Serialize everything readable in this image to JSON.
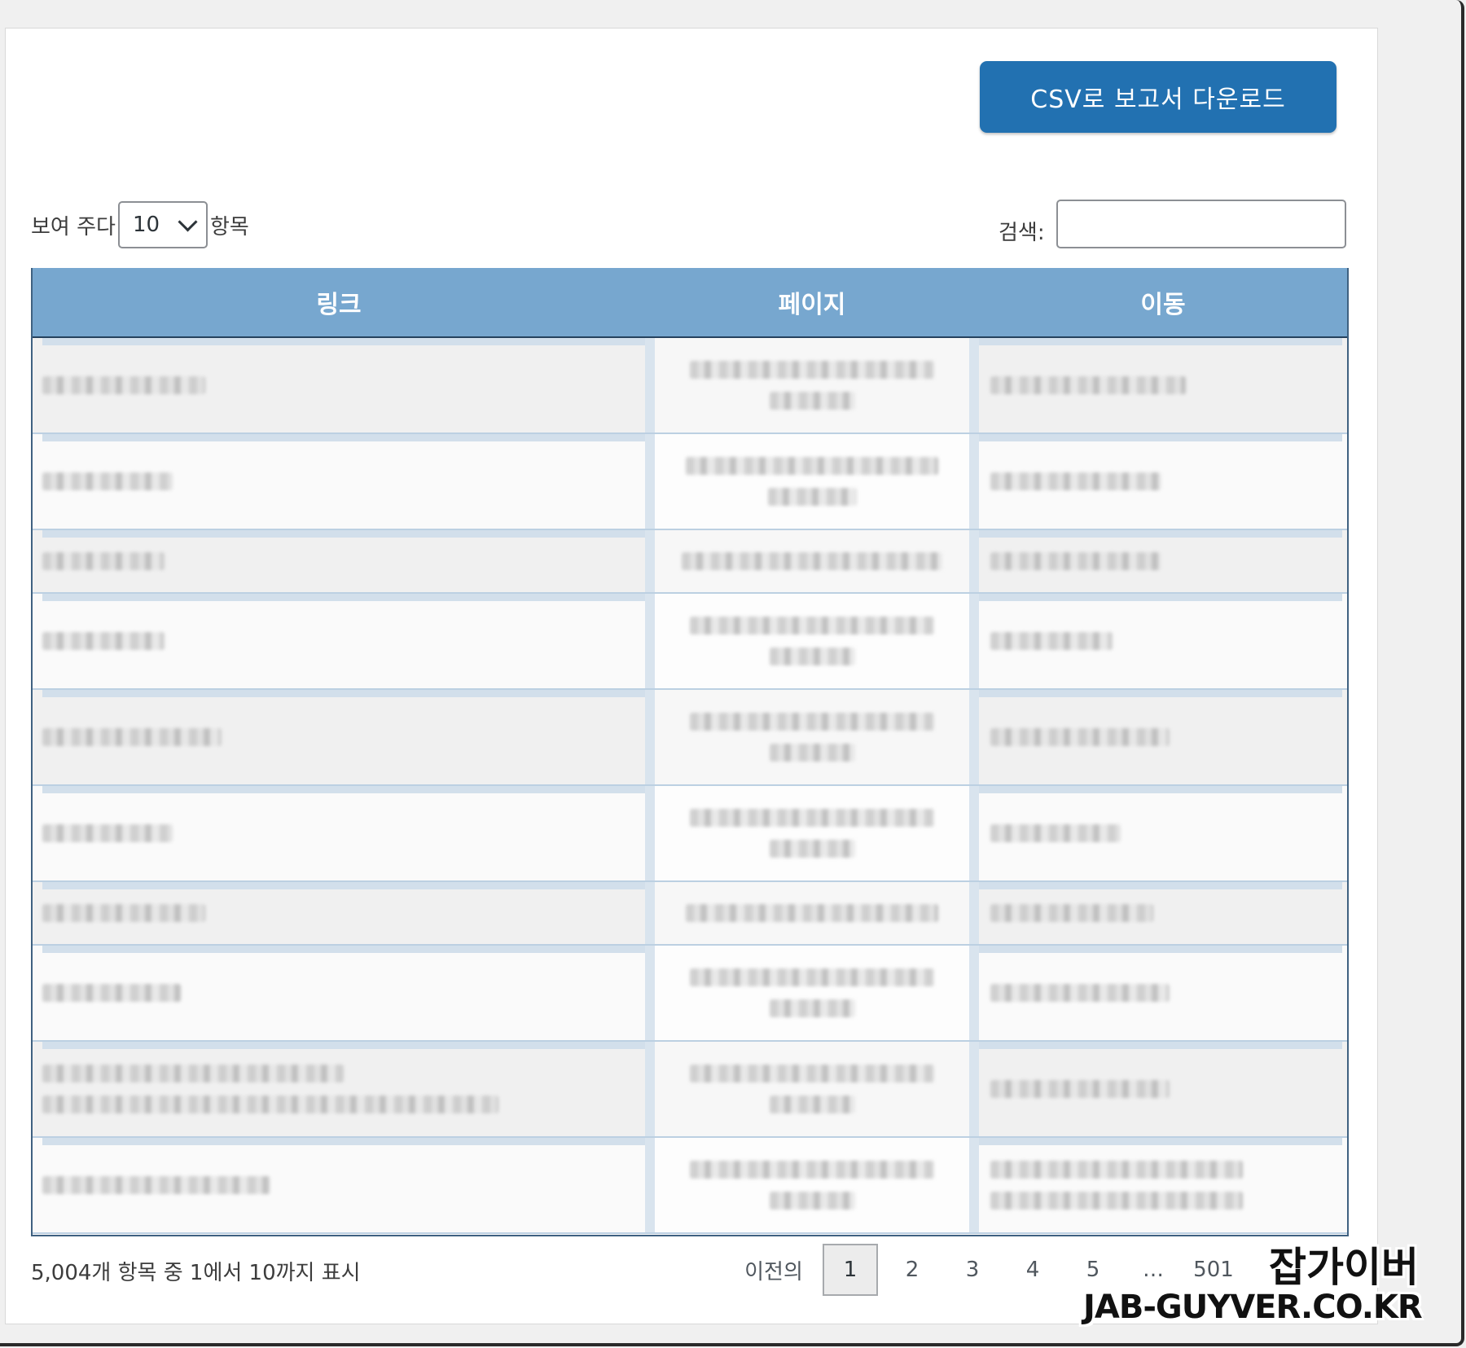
{
  "toolbar": {
    "csv_button_label": "CSV로 보고서 다운로드"
  },
  "length_menu": {
    "prefix": "보여 주다",
    "selected": "10",
    "suffix": "항목"
  },
  "search": {
    "label": "검색:",
    "value": ""
  },
  "table": {
    "columns": [
      "링크",
      "페이지",
      "이동"
    ],
    "rows": [
      {
        "link_lines": 1,
        "page_lines": 2,
        "dest_lines": 1
      },
      {
        "link_lines": 1,
        "page_lines": 2,
        "dest_lines": 1
      },
      {
        "link_lines": 1,
        "page_lines": 1,
        "dest_lines": 1
      },
      {
        "link_lines": 1,
        "page_lines": 2,
        "dest_lines": 1
      },
      {
        "link_lines": 1,
        "page_lines": 2,
        "dest_lines": 1
      },
      {
        "link_lines": 1,
        "page_lines": 2,
        "dest_lines": 1
      },
      {
        "link_lines": 1,
        "page_lines": 1,
        "dest_lines": 1
      },
      {
        "link_lines": 1,
        "page_lines": 2,
        "dest_lines": 1
      },
      {
        "link_lines": 2,
        "page_lines": 2,
        "dest_lines": 1
      },
      {
        "link_lines": 1,
        "page_lines": 2,
        "dest_lines": 2
      }
    ]
  },
  "footer": {
    "info": "5,004개 항목 중 1에서 10까지 표시",
    "pagination": {
      "prev": "이전의",
      "pages": [
        "1",
        "2",
        "3",
        "4",
        "5",
        "…",
        "501"
      ],
      "current": "1"
    }
  },
  "watermark": {
    "korean": "잡가이버",
    "url": "JAB-GUYVER.CO.KR"
  },
  "colors": {
    "accent": "#2271b1",
    "header_bg": "#77a7cf",
    "border": "#3f6181"
  }
}
